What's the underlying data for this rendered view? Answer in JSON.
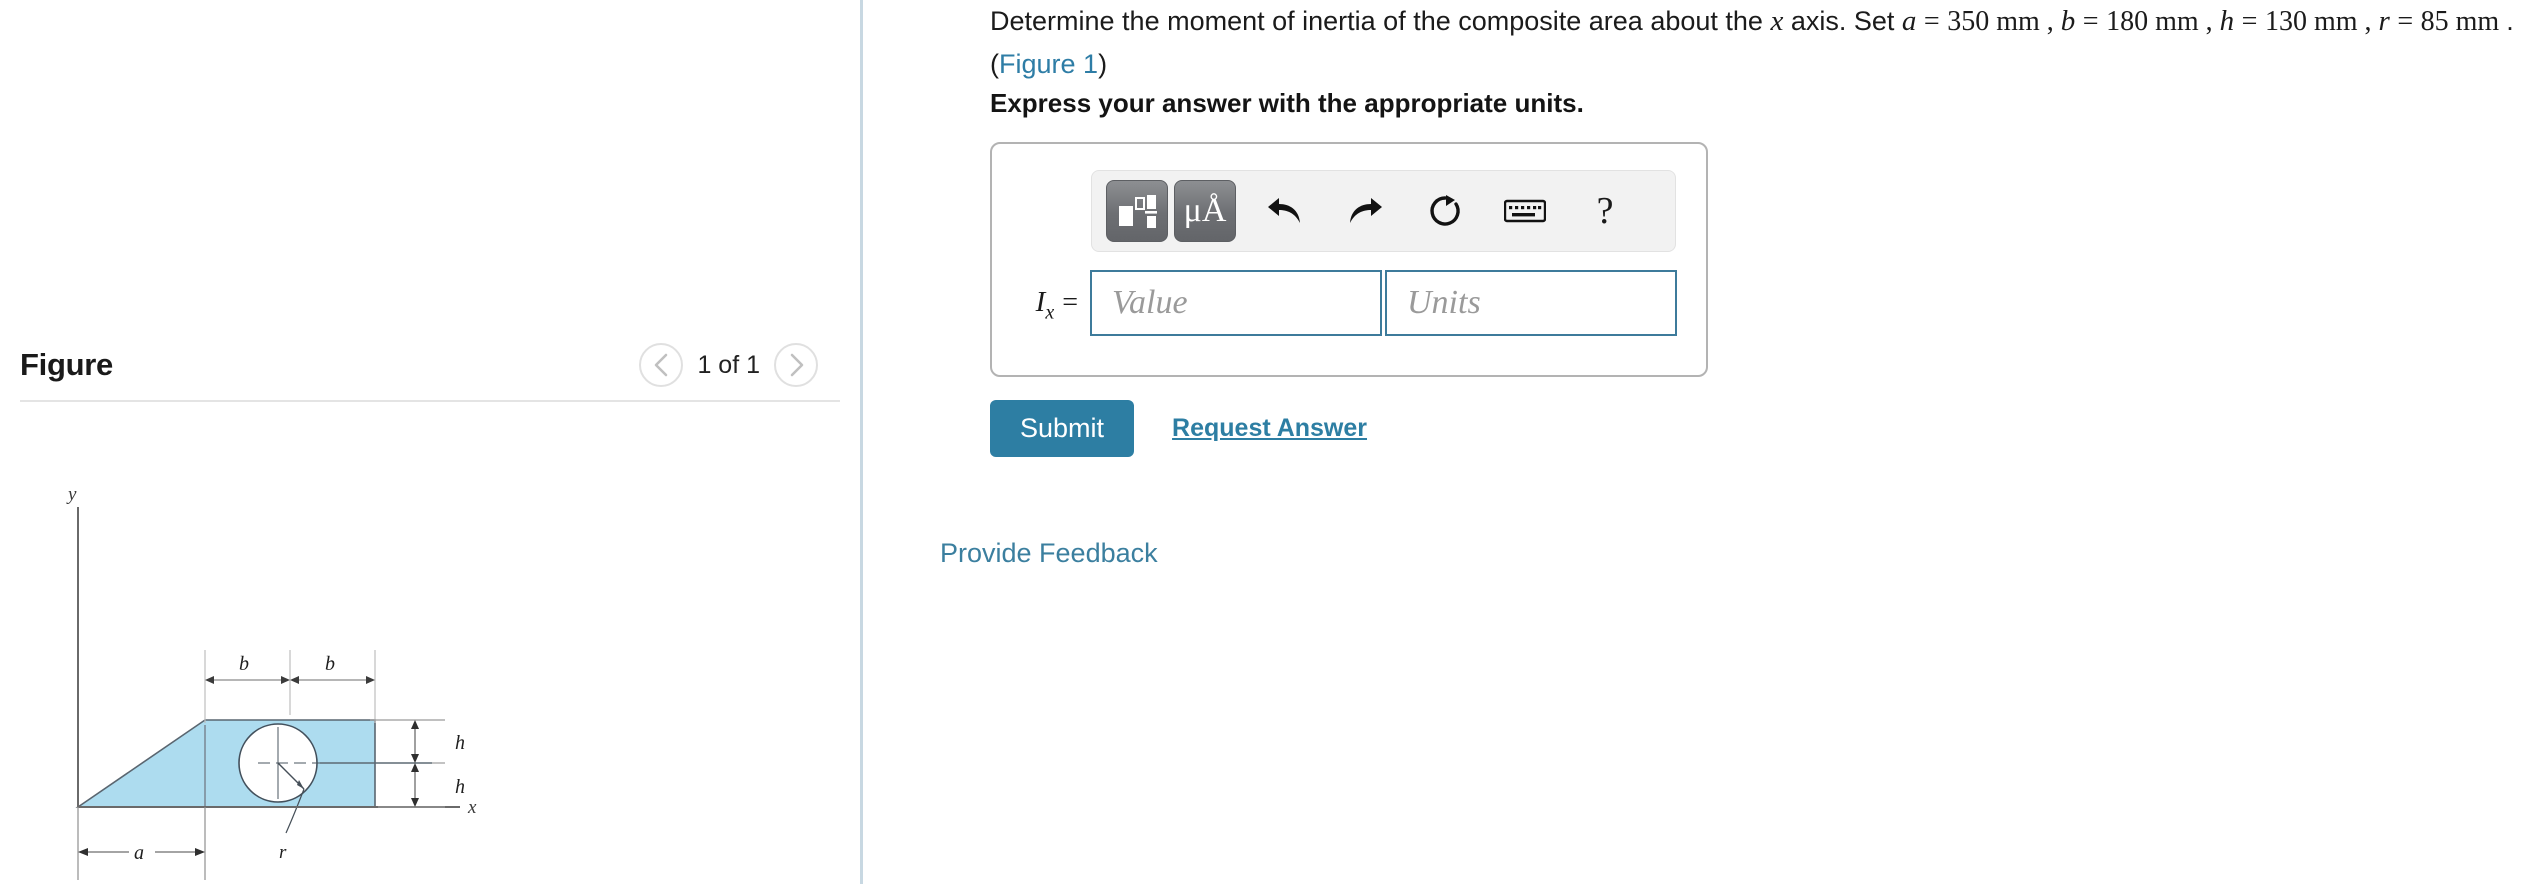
{
  "figure_panel": {
    "title": "Figure",
    "nav": {
      "prev_icon": "chevron-left-icon",
      "next_icon": "chevron-right-icon",
      "count_label": "1 of 1"
    },
    "diagram": {
      "type": "engineering-composite-area",
      "axis_labels": {
        "x": "x",
        "y": "y"
      },
      "dimension_labels": {
        "a": "a",
        "b_left": "b",
        "b_right": "b",
        "h_top": "h",
        "h_bottom": "h",
        "r": "r"
      },
      "fill_color": "#addcef",
      "outline_color": "#555f66",
      "shape_description": "trapezoid with rectangular right portion and circular hole"
    }
  },
  "question": {
    "prefix": "Determine the moment of inertia of the composite area about the ",
    "axis_var": "x",
    "middle": " axis. Set ",
    "variables": [
      {
        "name": "a",
        "eq": "=",
        "value": "350 mm"
      },
      {
        "name": "b",
        "eq": "=",
        "value": "180 mm"
      },
      {
        "name": "h",
        "eq": "=",
        "value": "130 mm"
      },
      {
        "name": "r",
        "eq": "=",
        "value": "85 mm"
      }
    ],
    "trailing": ".",
    "figure_ref_open": "(",
    "figure_ref_link": "Figure 1",
    "figure_ref_close": ")",
    "instruction": "Express your answer with the appropriate units."
  },
  "answer_box": {
    "toolbar": {
      "template_button": {
        "icon": "math-template-icon",
        "title": "Math templates"
      },
      "units_button": {
        "icon": "mu-angstrom-icon",
        "label": "μÅ"
      },
      "undo_button": {
        "icon": "undo-arrow-icon"
      },
      "redo_button": {
        "icon": "redo-arrow-icon"
      },
      "reset_button": {
        "icon": "reset-circle-icon"
      },
      "keyboard_button": {
        "icon": "keyboard-icon"
      },
      "help_button": {
        "icon": "question-mark-icon",
        "label": "?"
      }
    },
    "answer_label": "I",
    "answer_label_sub": "x",
    "answer_label_eq": "=",
    "value_field": {
      "value": "",
      "placeholder": "Value"
    },
    "units_field": {
      "value": "",
      "placeholder": "Units"
    }
  },
  "actions": {
    "submit_label": "Submit",
    "request_answer_label": "Request Answer",
    "provide_feedback_label": "Provide Feedback"
  },
  "colors": {
    "accent": "#2d7ea3",
    "link": "#2e7da6",
    "field_border": "#3d7b9b",
    "figure_fill": "#addcef",
    "divider": "#c8d8e2"
  }
}
